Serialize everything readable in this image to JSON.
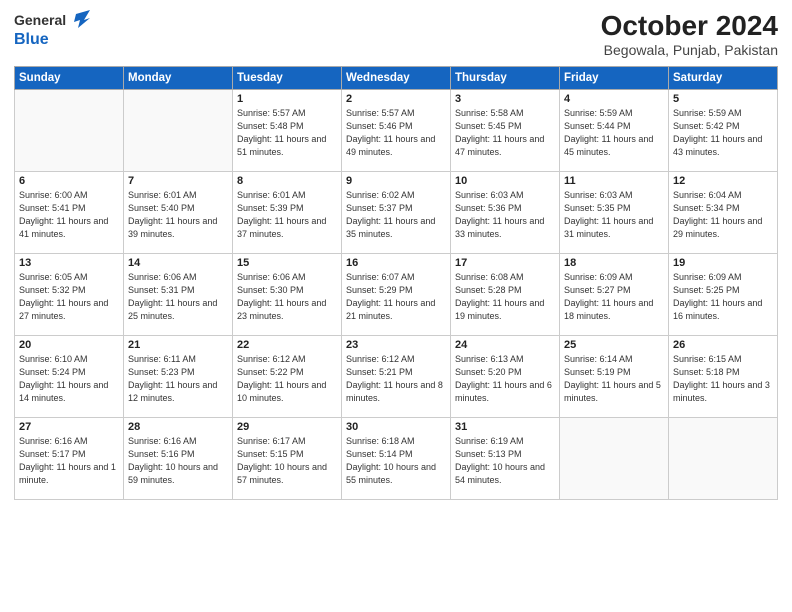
{
  "header": {
    "logo_general": "General",
    "logo_blue": "Blue",
    "month_title": "October 2024",
    "subtitle": "Begowala, Punjab, Pakistan"
  },
  "days_of_week": [
    "Sunday",
    "Monday",
    "Tuesday",
    "Wednesday",
    "Thursday",
    "Friday",
    "Saturday"
  ],
  "weeks": [
    [
      {
        "day": "",
        "info": ""
      },
      {
        "day": "",
        "info": ""
      },
      {
        "day": "1",
        "info": "Sunrise: 5:57 AM\nSunset: 5:48 PM\nDaylight: 11 hours and 51 minutes."
      },
      {
        "day": "2",
        "info": "Sunrise: 5:57 AM\nSunset: 5:46 PM\nDaylight: 11 hours and 49 minutes."
      },
      {
        "day": "3",
        "info": "Sunrise: 5:58 AM\nSunset: 5:45 PM\nDaylight: 11 hours and 47 minutes."
      },
      {
        "day": "4",
        "info": "Sunrise: 5:59 AM\nSunset: 5:44 PM\nDaylight: 11 hours and 45 minutes."
      },
      {
        "day": "5",
        "info": "Sunrise: 5:59 AM\nSunset: 5:42 PM\nDaylight: 11 hours and 43 minutes."
      }
    ],
    [
      {
        "day": "6",
        "info": "Sunrise: 6:00 AM\nSunset: 5:41 PM\nDaylight: 11 hours and 41 minutes."
      },
      {
        "day": "7",
        "info": "Sunrise: 6:01 AM\nSunset: 5:40 PM\nDaylight: 11 hours and 39 minutes."
      },
      {
        "day": "8",
        "info": "Sunrise: 6:01 AM\nSunset: 5:39 PM\nDaylight: 11 hours and 37 minutes."
      },
      {
        "day": "9",
        "info": "Sunrise: 6:02 AM\nSunset: 5:37 PM\nDaylight: 11 hours and 35 minutes."
      },
      {
        "day": "10",
        "info": "Sunrise: 6:03 AM\nSunset: 5:36 PM\nDaylight: 11 hours and 33 minutes."
      },
      {
        "day": "11",
        "info": "Sunrise: 6:03 AM\nSunset: 5:35 PM\nDaylight: 11 hours and 31 minutes."
      },
      {
        "day": "12",
        "info": "Sunrise: 6:04 AM\nSunset: 5:34 PM\nDaylight: 11 hours and 29 minutes."
      }
    ],
    [
      {
        "day": "13",
        "info": "Sunrise: 6:05 AM\nSunset: 5:32 PM\nDaylight: 11 hours and 27 minutes."
      },
      {
        "day": "14",
        "info": "Sunrise: 6:06 AM\nSunset: 5:31 PM\nDaylight: 11 hours and 25 minutes."
      },
      {
        "day": "15",
        "info": "Sunrise: 6:06 AM\nSunset: 5:30 PM\nDaylight: 11 hours and 23 minutes."
      },
      {
        "day": "16",
        "info": "Sunrise: 6:07 AM\nSunset: 5:29 PM\nDaylight: 11 hours and 21 minutes."
      },
      {
        "day": "17",
        "info": "Sunrise: 6:08 AM\nSunset: 5:28 PM\nDaylight: 11 hours and 19 minutes."
      },
      {
        "day": "18",
        "info": "Sunrise: 6:09 AM\nSunset: 5:27 PM\nDaylight: 11 hours and 18 minutes."
      },
      {
        "day": "19",
        "info": "Sunrise: 6:09 AM\nSunset: 5:25 PM\nDaylight: 11 hours and 16 minutes."
      }
    ],
    [
      {
        "day": "20",
        "info": "Sunrise: 6:10 AM\nSunset: 5:24 PM\nDaylight: 11 hours and 14 minutes."
      },
      {
        "day": "21",
        "info": "Sunrise: 6:11 AM\nSunset: 5:23 PM\nDaylight: 11 hours and 12 minutes."
      },
      {
        "day": "22",
        "info": "Sunrise: 6:12 AM\nSunset: 5:22 PM\nDaylight: 11 hours and 10 minutes."
      },
      {
        "day": "23",
        "info": "Sunrise: 6:12 AM\nSunset: 5:21 PM\nDaylight: 11 hours and 8 minutes."
      },
      {
        "day": "24",
        "info": "Sunrise: 6:13 AM\nSunset: 5:20 PM\nDaylight: 11 hours and 6 minutes."
      },
      {
        "day": "25",
        "info": "Sunrise: 6:14 AM\nSunset: 5:19 PM\nDaylight: 11 hours and 5 minutes."
      },
      {
        "day": "26",
        "info": "Sunrise: 6:15 AM\nSunset: 5:18 PM\nDaylight: 11 hours and 3 minutes."
      }
    ],
    [
      {
        "day": "27",
        "info": "Sunrise: 6:16 AM\nSunset: 5:17 PM\nDaylight: 11 hours and 1 minute."
      },
      {
        "day": "28",
        "info": "Sunrise: 6:16 AM\nSunset: 5:16 PM\nDaylight: 10 hours and 59 minutes."
      },
      {
        "day": "29",
        "info": "Sunrise: 6:17 AM\nSunset: 5:15 PM\nDaylight: 10 hours and 57 minutes."
      },
      {
        "day": "30",
        "info": "Sunrise: 6:18 AM\nSunset: 5:14 PM\nDaylight: 10 hours and 55 minutes."
      },
      {
        "day": "31",
        "info": "Sunrise: 6:19 AM\nSunset: 5:13 PM\nDaylight: 10 hours and 54 minutes."
      },
      {
        "day": "",
        "info": ""
      },
      {
        "day": "",
        "info": ""
      }
    ]
  ]
}
